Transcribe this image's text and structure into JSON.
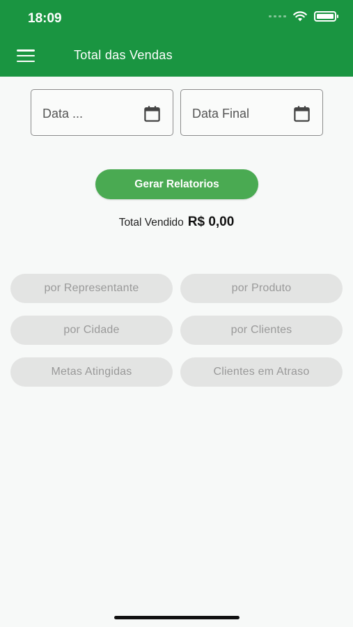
{
  "status_bar": {
    "time": "18:09"
  },
  "header": {
    "title": "Total das Vendas",
    "menu_icon": "hamburger-menu-icon"
  },
  "filters": {
    "start_date_label": "Data ...",
    "end_date_label": "Data Final",
    "calendar_icon": "calendar-icon"
  },
  "actions": {
    "generate_label": "Gerar Relatorios"
  },
  "summary": {
    "total_label": "Total Vendido",
    "total_value": "R$ 0,00"
  },
  "reports": [
    {
      "label": "por Representante"
    },
    {
      "label": "por Produto"
    },
    {
      "label": "por Cidade"
    },
    {
      "label": "por Clientes"
    },
    {
      "label": "Metas Atingidas"
    },
    {
      "label": "Clientes em Atraso"
    }
  ],
  "colors": {
    "app_bar": "#1a9541",
    "primary_button": "#4aaa52",
    "disabled_button": "#e3e4e3",
    "background": "#f7f9f8"
  }
}
